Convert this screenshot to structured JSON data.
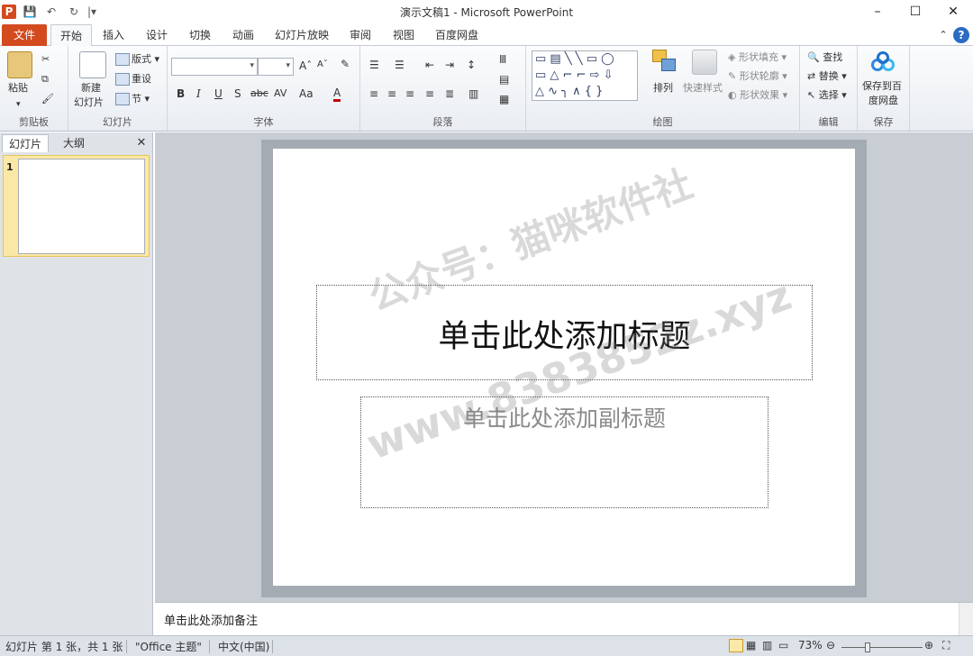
{
  "window": {
    "title": "演示文稿1 - Microsoft PowerPoint",
    "minimize": "–",
    "maximize": "☐",
    "close": "✕"
  },
  "quick_access": {
    "app_icon": "P",
    "save": "💾",
    "undo": "↶",
    "redo": "↻",
    "customize": "|▾"
  },
  "tabs": [
    "文件",
    "开始",
    "插入",
    "设计",
    "切换",
    "动画",
    "幻灯片放映",
    "审阅",
    "视图",
    "百度网盘"
  ],
  "ribbon": {
    "clipboard": {
      "label": "剪贴板",
      "paste": "粘贴"
    },
    "slides": {
      "label": "幻灯片",
      "new_slide_line1": "新建",
      "new_slide_line2": "幻灯片",
      "layout": "版式",
      "reset": "重设",
      "section": "节"
    },
    "font": {
      "label": "字体",
      "grow": "Aˆ",
      "shrink": "Aˇ",
      "bold": "B",
      "italic": "I",
      "underline": "U",
      "shadow": "S",
      "strike": "abc",
      "spacing": "AV",
      "case": "Aa",
      "color": "A"
    },
    "paragraph": {
      "label": "段落"
    },
    "drawing": {
      "label": "绘图",
      "arrange": "排列",
      "quick_styles": "快速样式",
      "shape_fill": "形状填充",
      "shape_outline": "形状轮廓",
      "shape_effects": "形状效果"
    },
    "editing": {
      "label": "编辑",
      "find": "查找",
      "replace": "替换",
      "select": "选择"
    },
    "save": {
      "label": "保存",
      "save_to_baidu_line1": "保存到百",
      "save_to_baidu_line2": "度网盘"
    }
  },
  "left_panel": {
    "tab_slides": "幻灯片",
    "tab_outline": "大纲",
    "close": "✕",
    "slide_number": "1"
  },
  "slide": {
    "title_placeholder": "单击此处添加标题",
    "subtitle_placeholder": "单击此处添加副标题"
  },
  "notes": {
    "placeholder": "单击此处添加备注"
  },
  "status": {
    "slide_info": "幻灯片 第 1 张，共 1 张",
    "theme": "\"Office 主题\"",
    "language": "中文(中国)",
    "zoom": "73%",
    "zoom_fraction": 0.73
  },
  "watermark": {
    "line1": "公众号：猫咪软件社",
    "line2": "www.8383852z.xyz"
  }
}
